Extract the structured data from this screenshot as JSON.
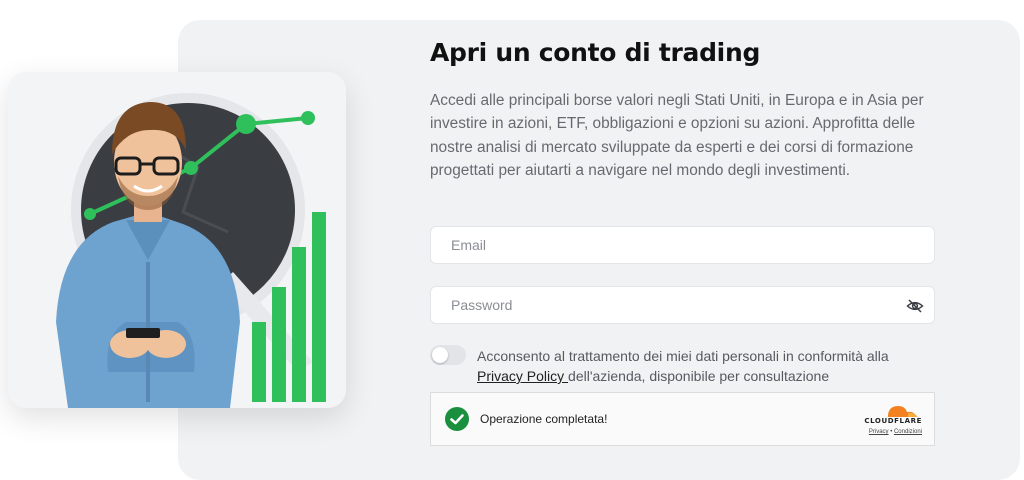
{
  "heading": {
    "title": "Apri un conto di trading"
  },
  "intro": {
    "text": "Accedi alle principali borse valori negli Stati Uniti, in Europa e in Asia per investire in azioni, ETF, obbligazioni e opzioni su azioni. Approfitta delle nostre analisi di mercato sviluppate da esperti e dei corsi di formazione progettati per aiutarti a navigare nel mondo degli investimenti."
  },
  "form": {
    "email_placeholder": "Email",
    "password_placeholder": "Password",
    "password_toggle_icon": "eye-off-icon",
    "consent_before": "Acconsento al trattamento dei miei dati personali in conformità alla ",
    "consent_link": "Privacy Policy ",
    "consent_after": "dell'azienda, disponibile per consultazione",
    "consent_checked": false
  },
  "captcha": {
    "status": "Operazione completata!",
    "check_icon": "check-circle-icon",
    "brand": "CLOUDFLARE",
    "privacy_label": "Privacy",
    "separator": " • ",
    "terms_label": "Condizioni"
  },
  "colors": {
    "accent_green": "#2fbf5b",
    "panel_bg": "#f1f2f4",
    "cloudflare_orange": "#f48120",
    "success_green": "#1a8f3d"
  }
}
